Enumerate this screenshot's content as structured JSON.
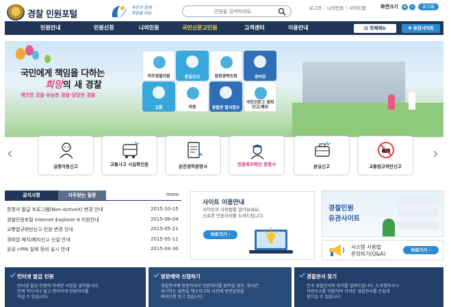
{
  "header": {
    "site_title": "경찰 민원포털",
    "slogan_line1": "국민과 함께",
    "slogan_line2": "희망을 여는",
    "search_placeholder": "민원을 검색하세요.",
    "util_links": [
      "로그인",
      "나의민원",
      "사이트맵"
    ],
    "font_size_label": "화면크기",
    "zoom_plus": "+",
    "zoom_minus": "-",
    "zoom_reset": "초기화"
  },
  "nav": {
    "items": [
      "민원안내",
      "민원신청",
      "나의민원",
      "국민신문고민원",
      "고객센터",
      "이용안내"
    ],
    "active_index": 3,
    "full_menu": "전체메뉴",
    "related_sites": "유관사이트"
  },
  "hero": {
    "headline_line1": "국민에게 책임을 다하는",
    "headline_accent": "희망",
    "headline_line2_rest": "의 새 경찰",
    "subline": "깨끗한 경찰·유능한 경찰·당당한 경찰",
    "tiles": [
      {
        "label": "의무경찰지원",
        "color": "#ffffff",
        "label_dark": true
      },
      {
        "label": "분실신고",
        "color": "#3aa7dc",
        "label_dark": false
      },
      {
        "label": "범죄경력조회",
        "color": "#ffffff",
        "label_dark": true
      },
      {
        "label": "경비업",
        "color": "#2e6fb8",
        "label_dark": false
      },
      {
        "label": "교통",
        "color": "#3aa7dc",
        "label_dark": false
      },
      {
        "label": "아동",
        "color": "#ffffff",
        "label_dark": true
      },
      {
        "label": "경찰관 협서접수",
        "color": "#2e6fb8",
        "label_dark": false
      },
      {
        "label": "국민신문고 범죄신고/제보",
        "color": "#ffffff",
        "label_dark": true
      }
    ]
  },
  "services": [
    {
      "label": "실종아동신고"
    },
    {
      "label": "교통사고 사실확인원"
    },
    {
      "label": "운전경력증명서"
    },
    {
      "label": "전경복무확인 증명서"
    },
    {
      "label": "분실신고"
    },
    {
      "label": "교통법규위반신고"
    }
  ],
  "notices": {
    "tab_active": "공지사항",
    "tab_inactive": "자주찾는 질문",
    "more": "more",
    "rows": [
      {
        "title": "증명서 발급 프로그램(Non-ActiveX) 변경 안내",
        "date": "2015-10-15"
      },
      {
        "title": "경찰민원포털 Internet Explorer 8 지원안내",
        "date": "2015-08-04"
      },
      {
        "title": "교통법규위반신고 민원 변경 안내",
        "date": "2015-05-21"
      },
      {
        "title": "경비업 배치/폐지신고 신설 안내",
        "date": "2015-05-11"
      },
      {
        "title": "공공 I-PIN 일제 정비 실시 안내",
        "date": "2015-04-30"
      }
    ]
  },
  "guide": {
    "title": "사이트 이용안내",
    "desc_line1": "사이트의 사용법을 알아보세요.",
    "desc_line2": "신속한 민원처리를 도와드립니다.",
    "button": "바로가기"
  },
  "right": {
    "banner_line1": "경찰민원",
    "banner_line2": "유관사이트",
    "guide_line1": "시스템 사용법",
    "guide_line2": "문의하기(Q&A)",
    "button": "바로가기"
  },
  "bottom": [
    {
      "title": "인터넷 발급 민원",
      "lines": [
        "인터넷 발급 민원의 자세한 사항을 알아봅시다.",
        "언제 어디서나 쉽고 편리하게 민원처리를",
        "하실 수 있습니다."
      ]
    },
    {
      "title": "방문예약 신청하기",
      "lines": [
        "경찰관서에 방문하셔서 민원처리를 원하실 경우, 장시간",
        "대기하는 불편을 해소하고자 사전에 방문일정을",
        "예약신청 받고 있습니다."
      ]
    },
    {
      "title": "경찰관서 찾기",
      "lines": [
        "전국 경찰관서의 위치를 알려드립니다. 도로명주소나",
        "지번주소를 이용하여 가까운 경찰관서를 손쉽게",
        "찾으실 수 있습니다."
      ]
    }
  ]
}
